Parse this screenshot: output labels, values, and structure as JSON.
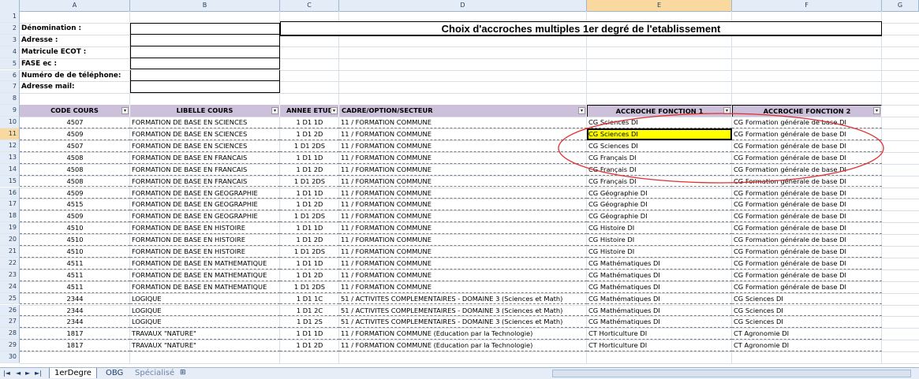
{
  "columns": [
    {
      "id": "A",
      "label": "A"
    },
    {
      "id": "B",
      "label": "B"
    },
    {
      "id": "C",
      "label": "C"
    },
    {
      "id": "D",
      "label": "D"
    },
    {
      "id": "E",
      "label": "E"
    },
    {
      "id": "F",
      "label": "F"
    },
    {
      "id": "G",
      "label": "G"
    }
  ],
  "row_numbers": [
    "1",
    "2",
    "3",
    "4",
    "5",
    "6",
    "7",
    "8",
    "9",
    "10",
    "11",
    "12",
    "13",
    "14",
    "15",
    "16",
    "17",
    "18",
    "19",
    "20",
    "21",
    "22",
    "23",
    "24",
    "25",
    "26",
    "27",
    "28",
    "29",
    "30"
  ],
  "title": "Choix d'accroches multiples 1er degré de l'etablissement",
  "info_labels": [
    "Dénomination :",
    "Adresse :",
    "Matricule ECOT :",
    "FASE ec :",
    "Numéro de de téléphone:",
    "Adresse mail:"
  ],
  "headers": [
    "CODE COURS",
    "LIBELLE COURS",
    "ANNEE ETUD",
    "CADRE/OPTION/SECTEUR",
    "ACCROCHE FONCTION 1",
    "ACCROCHE FONCTION 2"
  ],
  "rows": [
    [
      "4507",
      "FORMATION  DE BASE EN SCIENCES",
      "1 D1 1D",
      "11 / FORMATION COMMUNE",
      "CG Sciences DI",
      "CG Formation générale de base DI"
    ],
    [
      "4509",
      "FORMATION  DE BASE EN SCIENCES",
      "1 D1 2D",
      "11 / FORMATION COMMUNE",
      "CG Sciences DI",
      "CG Formation générale de base DI"
    ],
    [
      "4507",
      "FORMATION  DE BASE EN SCIENCES",
      "1 D1 2DS",
      "11 / FORMATION COMMUNE",
      "CG Sciences DI",
      "CG Formation générale de base DI"
    ],
    [
      "4508",
      "FORMATION DE BASE EN FRANCAIS",
      "1 D1 1D",
      "11 / FORMATION COMMUNE",
      "CG Français DI",
      "CG Formation générale de base DI"
    ],
    [
      "4508",
      "FORMATION DE BASE EN FRANCAIS",
      "1 D1 2D",
      "11 / FORMATION COMMUNE",
      "CG Français DI",
      "CG Formation générale de base DI"
    ],
    [
      "4508",
      "FORMATION DE BASE EN FRANCAIS",
      "1 D1 2DS",
      "11 / FORMATION COMMUNE",
      "CG Français DI",
      "CG Formation générale de base DI"
    ],
    [
      "4509",
      "FORMATION DE BASE EN GEOGRAPHIE",
      "1 D1 1D",
      "11 / FORMATION COMMUNE",
      "CG Géographie DI",
      "CG Formation générale de base DI"
    ],
    [
      "4515",
      "FORMATION DE BASE EN GEOGRAPHIE",
      "1 D1 2D",
      "11 / FORMATION COMMUNE",
      "CG Géographie DI",
      "CG Formation générale de base DI"
    ],
    [
      "4509",
      "FORMATION DE BASE EN GEOGRAPHIE",
      "1 D1 2DS",
      "11 / FORMATION COMMUNE",
      "CG Géographie DI",
      "CG Formation générale de base DI"
    ],
    [
      "4510",
      "FORMATION DE BASE EN HISTOIRE",
      "1 D1 1D",
      "11 / FORMATION COMMUNE",
      "CG Histoire DI",
      "CG Formation générale de base DI"
    ],
    [
      "4510",
      "FORMATION DE BASE EN HISTOIRE",
      "1 D1 2D",
      "11 / FORMATION COMMUNE",
      "CG Histoire DI",
      "CG Formation générale de base DI"
    ],
    [
      "4510",
      "FORMATION DE BASE EN HISTOIRE",
      "1 D1 2DS",
      "11 / FORMATION COMMUNE",
      "CG Histoire DI",
      "CG Formation générale de base DI"
    ],
    [
      "4511",
      "FORMATION DE BASE EN MATHEMATIQUE",
      "1 D1 1D",
      "11 / FORMATION COMMUNE",
      "CG Mathématiques DI",
      "CG Formation générale de base DI"
    ],
    [
      "4511",
      "FORMATION DE BASE EN MATHEMATIQUE",
      "1 D1 2D",
      "11 / FORMATION COMMUNE",
      "CG Mathématiques DI",
      "CG Formation générale de base DI"
    ],
    [
      "4511",
      "FORMATION DE BASE EN MATHEMATIQUE",
      "1 D1 2DS",
      "11 / FORMATION COMMUNE",
      "CG Mathématiques DI",
      "CG Formation générale de base DI"
    ],
    [
      "2344",
      "LOGIQUE",
      "1 D1 1C",
      "51 / ACTIVITES COMPLEMENTAIRES - DOMAINE 3 (Sciences et Math)",
      "CG Mathématiques DI",
      "CG Sciences DI"
    ],
    [
      "2344",
      "LOGIQUE",
      "1 D1 2C",
      "51 / ACTIVITES COMPLEMENTAIRES - DOMAINE 3 (Sciences et Math)",
      "CG Mathématiques DI",
      "CG Sciences DI"
    ],
    [
      "2344",
      "LOGIQUE",
      "1 D1 2S",
      "51 / ACTIVITES COMPLEMENTAIRES - DOMAINE 3 (Sciences et Math)",
      "CG Mathématiques DI",
      "CG Sciences DI"
    ],
    [
      "1817",
      "TRAVAUX \"NATURE\"",
      "1 D1 1D",
      "11 / FORMATION COMMUNE (Education par la Technologie)",
      "CT Horticulture DI",
      "CT Agronomie DI"
    ],
    [
      "1817",
      "TRAVAUX \"NATURE\"",
      "1 D1 2D",
      "11 / FORMATION COMMUNE (Education par la Technologie)",
      "CT Horticulture DI",
      "CT Agronomie DI"
    ]
  ],
  "selected_cell": {
    "row": "11",
    "col": "E"
  },
  "tabs": {
    "nav": [
      "|◄",
      "◄",
      "►",
      "►|"
    ],
    "sheets": [
      "1erDegre",
      "OBG",
      "Spécialisé"
    ]
  },
  "colors": {
    "header_fill": "#ccc0da",
    "highlight": "#ffff00",
    "annotation": "#e03030"
  }
}
